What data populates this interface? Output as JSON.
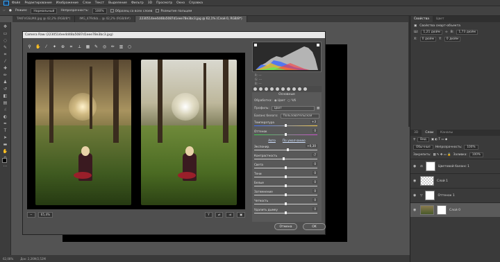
{
  "menu": [
    "Файл",
    "Редактирование",
    "Изображение",
    "Слои",
    "Текст",
    "Выделение",
    "Фильтр",
    "3D",
    "Просмотр",
    "Окно",
    "Справка"
  ],
  "options": {
    "mode_label": "Режим:",
    "mode_value": "Нормальный",
    "opacity_label": "Непрозрачность:",
    "opacity_value": "100%",
    "sample_label": "Образец со всех слоев",
    "smoothing_label": "Размытие пальцем"
  },
  "tabs": [
    {
      "label": "TAKFVGSLM4.jpg @ 42,2% (RGB/8*)"
    },
    {
      "label": "IMG_47Rdkb... @ 42,2% (RGB/8#)"
    },
    {
      "label": "2230514ee4d48a5087d1eee78e3bc3.jpg @ 62,1% (Слой 0, RGB/8*)",
      "active": true
    }
  ],
  "status": {
    "zoom": "62,08%",
    "doc": "Док: 2,26M/2,52M"
  },
  "right_panel": {
    "tabs": [
      "Свойства",
      "Цвет"
    ],
    "props_title": "Свойства смарт-объекта",
    "w_label": "Ш:",
    "w_value": "1,21 дюйм",
    "h_label": "В:",
    "h_value": "1,73 дюйм",
    "x_label": "X:",
    "x_value": "0 дюйм",
    "y_label": "Y:",
    "y_value": "0 дюйм"
  },
  "layers_panel": {
    "tabs": [
      "3D",
      "Слои",
      "Каналы"
    ],
    "kind_label": "Вид",
    "blend": "Обычные",
    "opacity_label": "Непрозрачность:",
    "opacity_value": "100%",
    "lock_label": "Закрепить:",
    "fill_label": "Заливка:",
    "fill_value": "100%",
    "layers": [
      {
        "name": "Цветовой баланс 1"
      },
      {
        "name": "Слой 1"
      },
      {
        "name": "Оттенок 1"
      },
      {
        "name": "Слой 0"
      }
    ]
  },
  "camera_raw": {
    "title": "Camera Raw (2230514ee4d48a5087d1eee78e3bc3.jpg)",
    "zoom": "65,4%",
    "rgb": [
      "R:",
      "G:",
      "B:"
    ],
    "rgb_values": [
      "---",
      "---",
      "---"
    ],
    "section": "Основные",
    "treatment_label": "Обработка:",
    "treatment_color": "Цвет",
    "treatment_bw": "Ч/б",
    "profile_label": "Профиль:",
    "profile_value": "Цвет",
    "wb_label": "Баланс белого:",
    "wb_value": "Пользовательская",
    "auto": "Авто",
    "default": "По умолчанию",
    "sliders": [
      {
        "label": "Температура",
        "value": "+3",
        "pos": 0.5
      },
      {
        "label": "Оттенок",
        "value": "0",
        "pos": 0.5
      },
      {
        "label": "Экспонир.",
        "value": "+0,30",
        "pos": 0.53
      },
      {
        "label": "Контрастность",
        "value": "-7",
        "pos": 0.47
      },
      {
        "label": "Света",
        "value": "0",
        "pos": 0.5
      },
      {
        "label": "Тени",
        "value": "0",
        "pos": 0.5
      },
      {
        "label": "Белые",
        "value": "0",
        "pos": 0.5
      },
      {
        "label": "Затемнение",
        "value": "0",
        "pos": 0.5
      },
      {
        "label": "Четкость",
        "value": "0",
        "pos": 0.5
      },
      {
        "label": "Удалить дымку",
        "value": "0",
        "pos": 0.5
      }
    ],
    "cancel": "Отмена",
    "ok": "OK"
  }
}
